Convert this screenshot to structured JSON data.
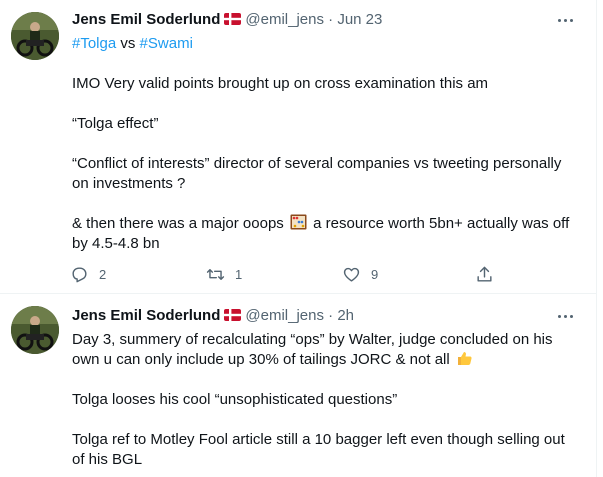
{
  "tweets": [
    {
      "name": "Jens Emil Soderlund",
      "handle": "@emil_jens",
      "separator": "·",
      "time": "Jun 23",
      "hashtag1": "#Tolga",
      "vs": " vs ",
      "hashtag2": "#Swami",
      "p1": "IMO Very valid points brought up on cross examination this am",
      "p2": "“Tolga effect”",
      "p3": "“Conflict of interests” director of several companies vs tweeting personally on investments ?",
      "p4a": "& then there was a major ooops",
      "p4b": " a resource worth 5bn+ actually was off by 4.5-4.8 bn",
      "reply_count": "2",
      "retweet_count": "1",
      "like_count": "9",
      "icons": {
        "reply": "reply-icon",
        "retweet": "retweet-icon",
        "like": "heart-icon",
        "share": "share-icon",
        "emoji": "abacus-emoji",
        "flag": "denmark-flag-emoji"
      }
    },
    {
      "name": "Jens Emil Soderlund",
      "handle": "@emil_jens",
      "separator": "·",
      "time": "2h",
      "p1": "Day 3, summery of recalculating “ops” by Walter, judge concluded on his own u can only include up 30% of tailings JORC & not all",
      "p2": "Tolga looses his cool “unsophisticated questions”",
      "p3": "Tolga ref to Motley Fool article still a 10 bagger left even though selling out of his BGL",
      "icons": {
        "emoji": "thumbs-up-emoji",
        "flag": "denmark-flag-emoji"
      }
    }
  ],
  "colors": {
    "link": "#1d9bf0",
    "secondary": "#536471",
    "text": "#0f1419",
    "border": "#eff3f4"
  }
}
